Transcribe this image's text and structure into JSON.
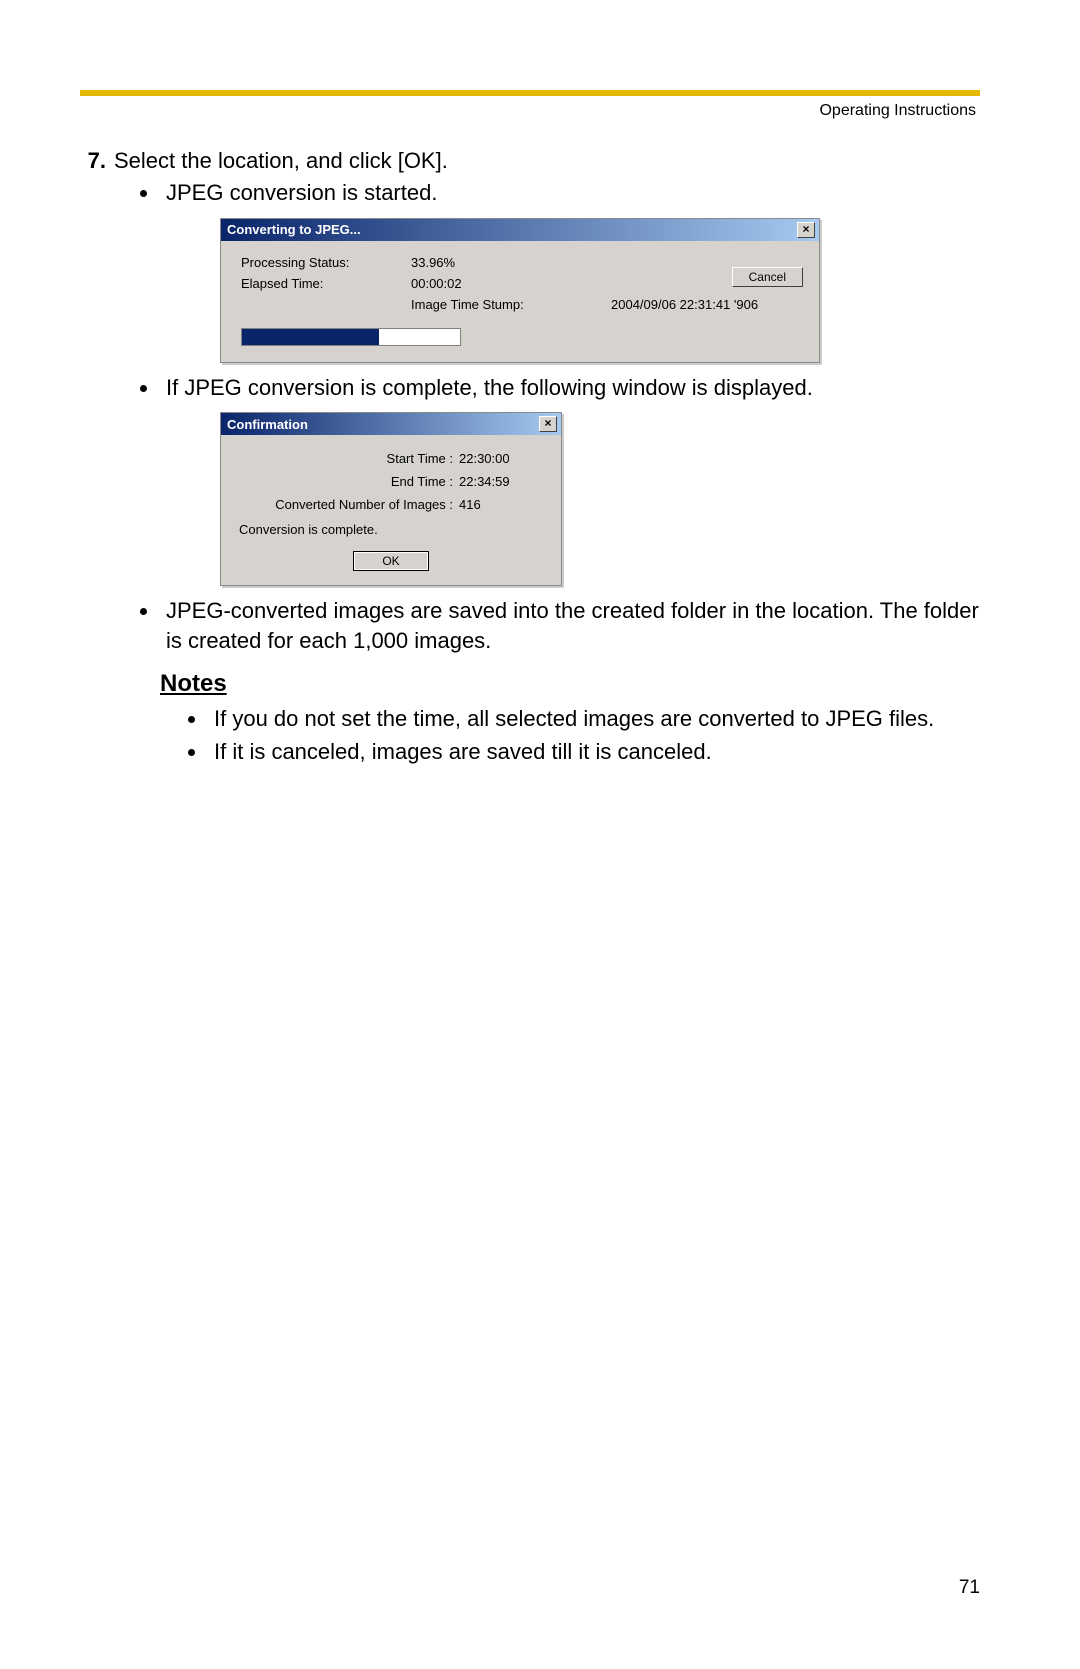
{
  "header": {
    "running_head": "Operating Instructions"
  },
  "step": {
    "number": "7.",
    "text": "Select the location, and click [OK].",
    "bullets": {
      "b1": "JPEG conversion is started.",
      "b2": "If JPEG conversion is complete, the following window is displayed.",
      "b3": "JPEG-converted images are saved into the created folder in the location. The folder is created for each 1,000 images."
    }
  },
  "dialog1": {
    "title": "Converting to JPEG...",
    "close_glyph": "×",
    "labels": {
      "processing": "Processing Status:",
      "elapsed": "Elapsed Time:",
      "stump": "Image Time Stump:"
    },
    "values": {
      "processing": "33.96%",
      "elapsed": "00:00:02",
      "stump": "2004/09/06 22:31:41 '906"
    },
    "cancel": "Cancel"
  },
  "dialog2": {
    "title": "Confirmation",
    "close_glyph": "×",
    "rows": {
      "start_label": "Start Time :",
      "start_val": "22:30:00",
      "end_label": "End Time :",
      "end_val": "22:34:59",
      "count_label": "Converted Number of Images :",
      "count_val": "416"
    },
    "message": "Conversion is complete.",
    "ok": "OK"
  },
  "notes": {
    "heading": "Notes",
    "n1": "If you do not set the time, all selected images are converted to JPEG files.",
    "n2": "If it is canceled, images are saved till it is canceled."
  },
  "page_number": "71"
}
